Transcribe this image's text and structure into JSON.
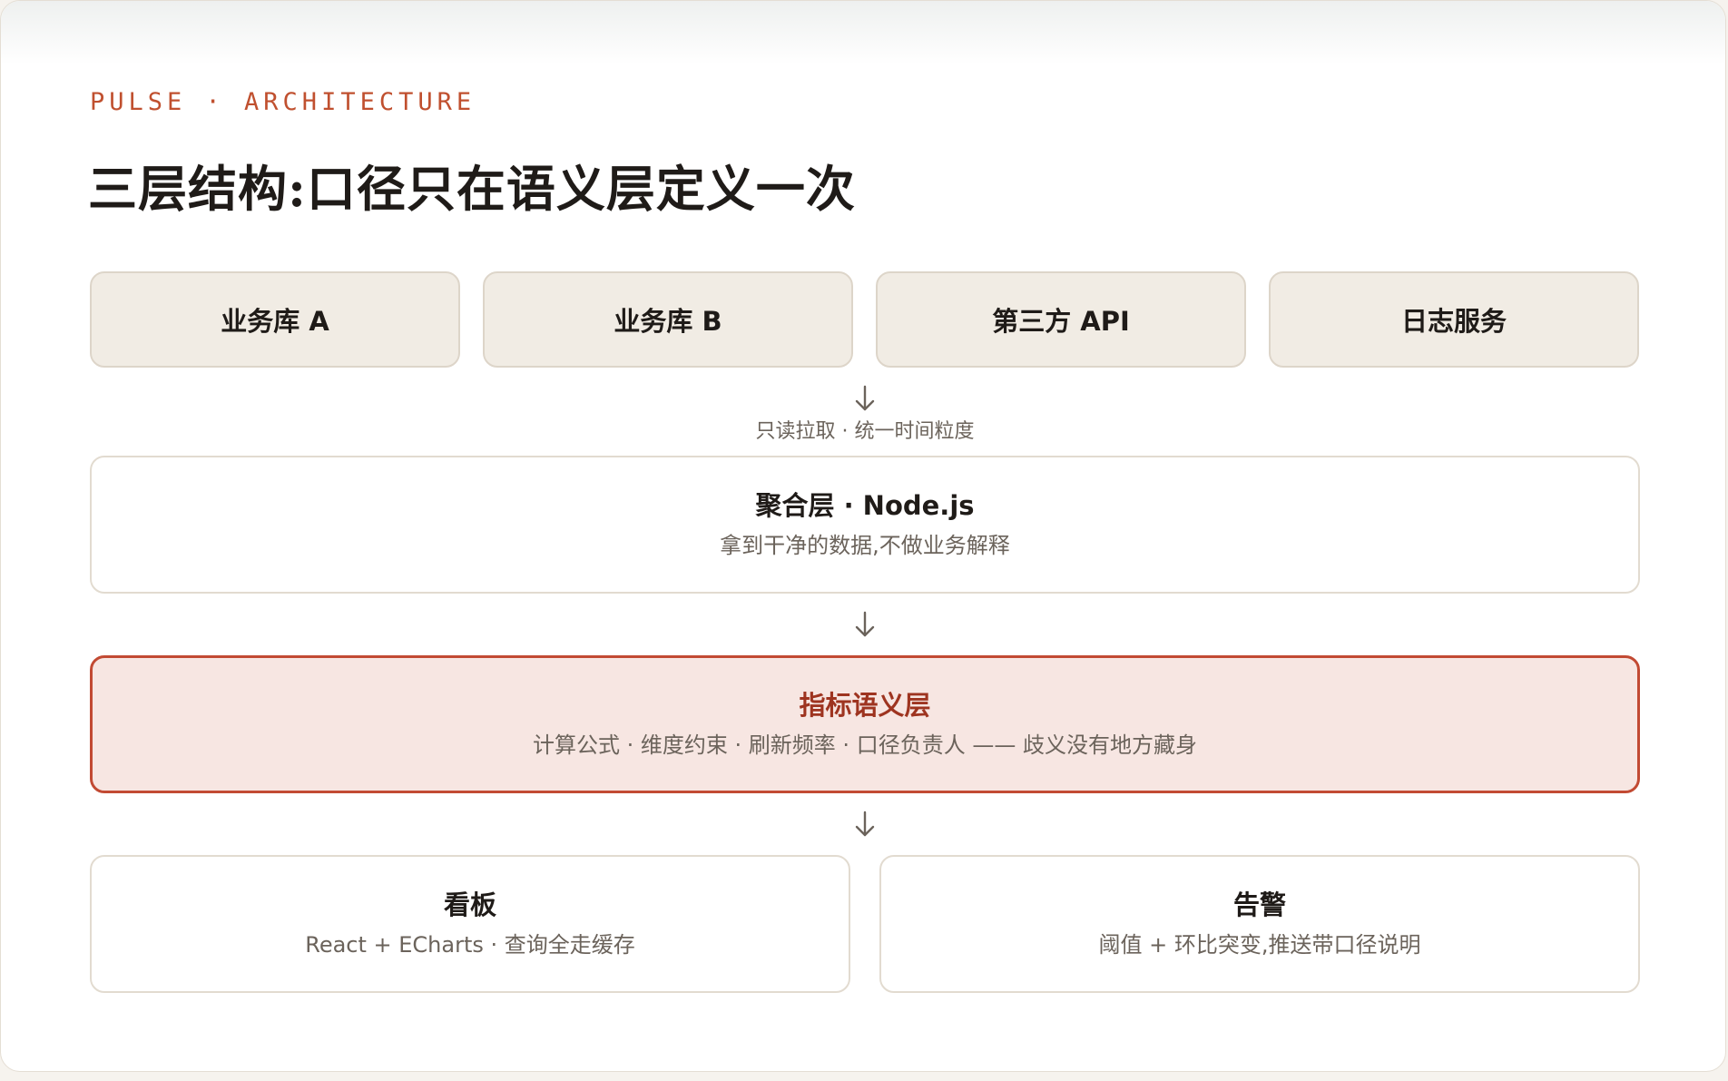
{
  "header": {
    "eyebrow": "PULSE · ARCHITECTURE",
    "title": "三层结构:口径只在语义层定义一次"
  },
  "sources": [
    {
      "label": "业务库 A"
    },
    {
      "label": "业务库 B"
    },
    {
      "label": "第三方 API"
    },
    {
      "label": "日志服务"
    }
  ],
  "connectors": {
    "sources_to_aggregation": "只读拉取 · 统一时间粒度"
  },
  "aggregation": {
    "name": "聚合层 · Node.js",
    "desc": "拿到干净的数据,不做业务解释"
  },
  "semantic": {
    "name": "指标语义层",
    "desc": "计算公式 · 维度约束 · 刷新频率 · 口径负责人 —— 歧义没有地方藏身",
    "accent_color": "#c24a33"
  },
  "consumers": [
    {
      "name": "看板",
      "desc": "React + ECharts · 查询全走缓存"
    },
    {
      "name": "告警",
      "desc": "阈值 + 环比突变,推送带口径说明"
    }
  ],
  "icons": {
    "arrow": "arrow-down-icon"
  }
}
